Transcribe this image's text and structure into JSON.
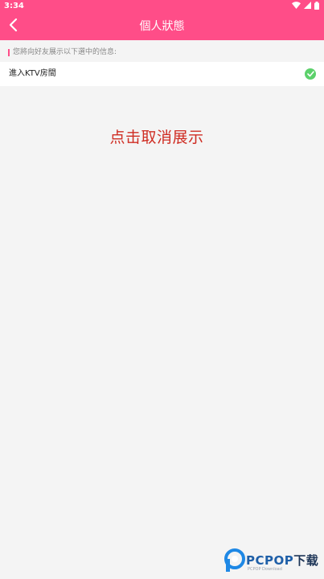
{
  "status_bar": {
    "time": "3:34",
    "icons": [
      "wifi-icon",
      "signal-icon",
      "battery-icon"
    ]
  },
  "header": {
    "title": "個人狀態",
    "back_icon": "chevron-left-icon"
  },
  "section": {
    "hint": "您將向好友展示以下選中的信息:"
  },
  "options": [
    {
      "label": "進入KTV房間",
      "checked": true,
      "icon": "check-circle-icon"
    }
  ],
  "annotation": "点击取消展示",
  "watermark": {
    "brand": "PCPOP",
    "brand_suffix": "下载",
    "sub": "PCPOP Download"
  },
  "colors": {
    "brand_pink": "#ff4d88",
    "check_green": "#5cd16b",
    "annotation_red": "#cf2d23",
    "page_bg": "#f4f4f4"
  }
}
